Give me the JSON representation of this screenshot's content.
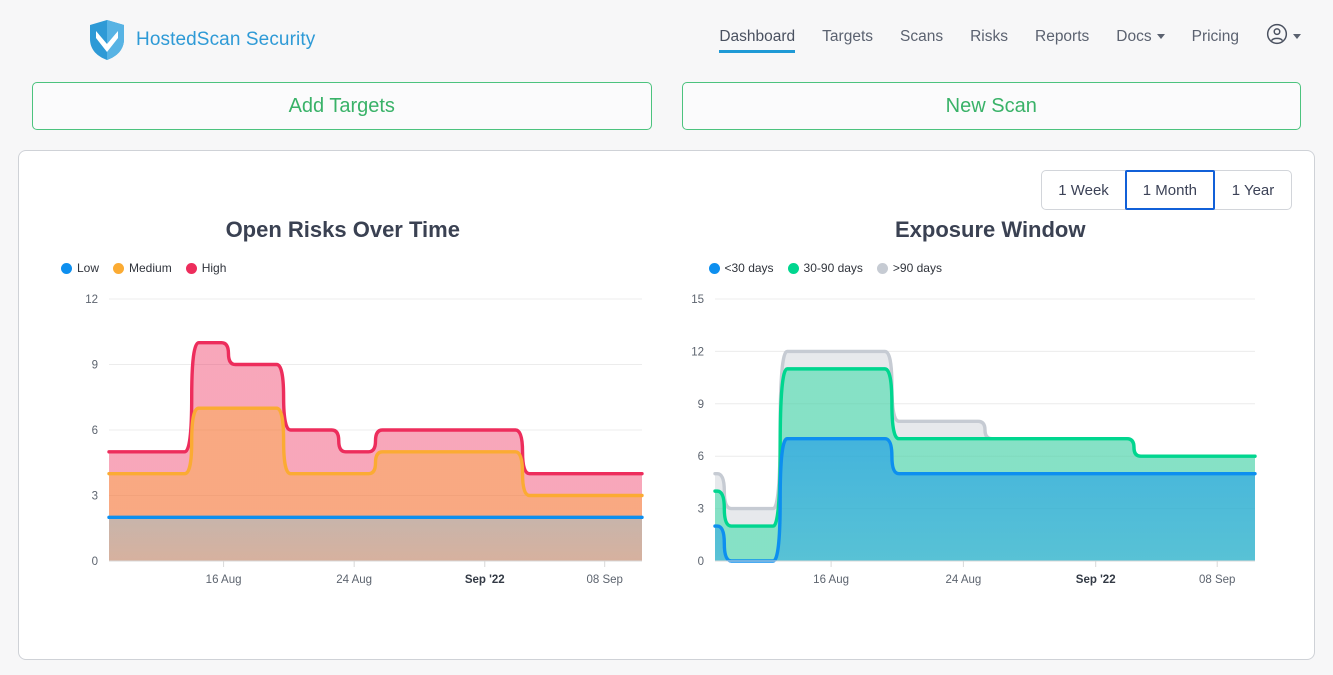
{
  "header": {
    "brand_name": "HostedScan Security",
    "logo_icon": "shield-check-icon",
    "nav": [
      {
        "label": "Dashboard",
        "active": true,
        "dropdown": false
      },
      {
        "label": "Targets",
        "active": false,
        "dropdown": false
      },
      {
        "label": "Scans",
        "active": false,
        "dropdown": false
      },
      {
        "label": "Risks",
        "active": false,
        "dropdown": false
      },
      {
        "label": "Reports",
        "active": false,
        "dropdown": false
      },
      {
        "label": "Docs",
        "active": false,
        "dropdown": true
      },
      {
        "label": "Pricing",
        "active": false,
        "dropdown": false
      }
    ],
    "account_icon": "user-circle-icon",
    "account_caret_icon": "chevron-down-icon"
  },
  "actions": {
    "add_targets": "Add Targets",
    "new_scan": "New Scan"
  },
  "range_selector": {
    "options": [
      "1 Week",
      "1 Month",
      "1 Year"
    ],
    "selected": "1 Month",
    "selected_border_color": "#1160d8"
  },
  "colors": {
    "low": "#0d8fef",
    "medium": "#fbab33",
    "high": "#ed2d5c",
    "lt30": "#0d8fef",
    "d30_90": "#00d68f",
    "gt90": "#c6cbd3",
    "brand_blue": "#2e9ad6",
    "accent_green": "#39b268",
    "nav_underline": "#1f9ad6"
  },
  "chart_data": [
    {
      "type": "area",
      "stacked": true,
      "title": "Open Risks Over Time",
      "xlabel": "",
      "ylabel": "",
      "ylim": [
        0,
        12
      ],
      "yticks": [
        0,
        3,
        6,
        9,
        12
      ],
      "grid": true,
      "legend_position": "top-left",
      "xticks": [
        "16 Aug",
        "24 Aug",
        "Sep '22",
        "08 Sep"
      ],
      "xtick_bold": [
        "Sep '22"
      ],
      "x": [
        0,
        1,
        2,
        3,
        4,
        5,
        6,
        7,
        8,
        9,
        10,
        11,
        12,
        13,
        14,
        15,
        16,
        17,
        18,
        19,
        20,
        21,
        22,
        23,
        24,
        25,
        26,
        27,
        28,
        29
      ],
      "series": [
        {
          "name": "Low",
          "color": "#0d8fef",
          "values": [
            2,
            2,
            2,
            2,
            2,
            2,
            2,
            2,
            2,
            2,
            2,
            2,
            2,
            2,
            2,
            2,
            2,
            2,
            2,
            2,
            2,
            2,
            2,
            2,
            2,
            2,
            2,
            2,
            2,
            2
          ]
        },
        {
          "name": "Medium",
          "color": "#fbab33",
          "values": [
            2,
            2,
            2,
            2,
            2,
            5,
            5,
            5,
            5,
            5,
            2,
            2,
            2,
            2,
            2,
            3,
            3,
            3,
            3,
            3,
            3,
            3,
            3,
            1,
            1,
            1,
            1,
            1,
            1,
            1
          ]
        },
        {
          "name": "High",
          "color": "#ed2d5c",
          "values": [
            1,
            1,
            1,
            1,
            1,
            3,
            3,
            2,
            2,
            2,
            2,
            2,
            2,
            1,
            1,
            0,
            0,
            0,
            0,
            0,
            0,
            0,
            0,
            1,
            1,
            1,
            1,
            1,
            1,
            1
          ]
        }
      ],
      "cumulative_tops": {
        "Low": [
          2,
          2,
          2,
          2,
          2,
          2,
          2,
          2,
          2,
          2,
          2,
          2,
          2,
          2,
          2,
          2,
          2,
          2,
          2,
          2,
          2,
          2,
          2,
          2,
          2,
          2,
          2,
          2,
          2,
          2
        ],
        "Medium": [
          4,
          4,
          4,
          4,
          4,
          7,
          7,
          7,
          7,
          7,
          4,
          4,
          4,
          4,
          4,
          5,
          5,
          5,
          5,
          5,
          5,
          5,
          5,
          3,
          3,
          3,
          3,
          3,
          3,
          3
        ],
        "High": [
          5,
          5,
          5,
          5,
          5,
          10,
          10,
          9,
          9,
          9,
          6,
          6,
          6,
          5,
          5,
          6,
          6,
          6,
          6,
          6,
          6,
          6,
          6,
          4,
          4,
          4,
          4,
          4,
          4,
          4
        ]
      }
    },
    {
      "type": "area",
      "stacked": true,
      "title": "Exposure Window",
      "xlabel": "",
      "ylabel": "",
      "ylim": [
        0,
        15
      ],
      "yticks": [
        0,
        3,
        6,
        9,
        12,
        15
      ],
      "grid": true,
      "legend_position": "top-left",
      "xticks": [
        "16 Aug",
        "24 Aug",
        "Sep '22",
        "08 Sep"
      ],
      "xtick_bold": [
        "Sep '22"
      ],
      "x": [
        0,
        1,
        2,
        3,
        4,
        5,
        6,
        7,
        8,
        9,
        10,
        11,
        12,
        13,
        14,
        15,
        16,
        17,
        18,
        19,
        20,
        21,
        22,
        23,
        24,
        25,
        26,
        27,
        28,
        29
      ],
      "series": [
        {
          "name": "<30 days",
          "color": "#0d8fef",
          "values": [
            2,
            0,
            0,
            0,
            7,
            7,
            7,
            7,
            7,
            7,
            5,
            5,
            5,
            5,
            5,
            5,
            5,
            5,
            5,
            5,
            5,
            5,
            5,
            5,
            5,
            5,
            5,
            5,
            5,
            5
          ]
        },
        {
          "name": "30-90 days",
          "color": "#00d68f",
          "values": [
            2,
            2,
            2,
            2,
            4,
            4,
            4,
            4,
            4,
            4,
            2,
            2,
            2,
            2,
            2,
            2,
            2,
            2,
            2,
            2,
            2,
            2,
            2,
            1,
            1,
            1,
            1,
            1,
            1,
            1
          ]
        },
        {
          "name": ">90 days",
          "color": "#c6cbd3",
          "values": [
            1,
            1,
            1,
            1,
            1,
            1,
            1,
            1,
            1,
            1,
            1,
            1,
            1,
            1,
            1,
            0,
            0,
            0,
            0,
            0,
            0,
            0,
            0,
            0,
            0,
            0,
            0,
            0,
            0,
            0
          ]
        }
      ],
      "cumulative_tops": {
        "<30 days": [
          2,
          0,
          0,
          0,
          7,
          7,
          7,
          7,
          7,
          7,
          5,
          5,
          5,
          5,
          5,
          5,
          5,
          5,
          5,
          5,
          5,
          5,
          5,
          5,
          5,
          5,
          5,
          5,
          5,
          5
        ],
        "30-90 days": [
          4,
          2,
          2,
          2,
          11,
          11,
          11,
          11,
          11,
          11,
          7,
          7,
          7,
          7,
          7,
          7,
          7,
          7,
          7,
          7,
          7,
          7,
          7,
          6,
          6,
          6,
          6,
          6,
          6,
          6
        ],
        ">90 days": [
          5,
          3,
          3,
          3,
          12,
          12,
          12,
          12,
          12,
          12,
          8,
          8,
          8,
          8,
          8,
          7,
          7,
          7,
          7,
          7,
          7,
          7,
          7,
          6,
          6,
          6,
          6,
          6,
          6,
          6
        ]
      }
    }
  ]
}
